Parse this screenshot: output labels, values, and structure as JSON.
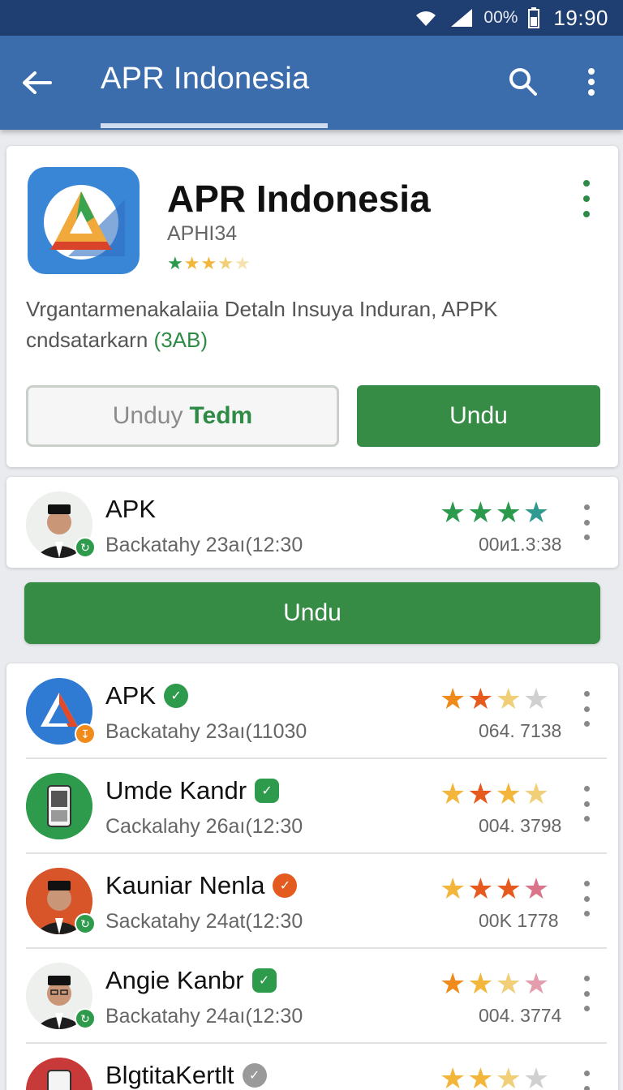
{
  "status_bar": {
    "battery": "00%",
    "time": "19:90"
  },
  "app_bar": {
    "title": "APR Indonesia"
  },
  "hero": {
    "app_name": "APR Indonesia",
    "app_id": "APHI34",
    "rating_stars": 3.5,
    "description_main": "Vrgantarmenakalaiia Detaln Insuya Induran, APPK cndsatarkarn ",
    "description_highlight": "(3AB)",
    "btn_outline_part1": "Unduy",
    "btn_outline_part2": "Tedm",
    "btn_fill": "Undu"
  },
  "featured_row": {
    "name": "APK",
    "subtitle": "Backatahy 23aı(12:30",
    "count": "00и1.3ː38",
    "stars": 4
  },
  "big_button": "Undu",
  "list": [
    {
      "name": "APK",
      "subtitle": "Backatahy 23aı(11030",
      "count": "064. 7138",
      "stars": 2.5,
      "accent": "#2e9a4b"
    },
    {
      "name": "Umde Kandr",
      "subtitle": "Cackalahy 26aı(12:30",
      "count": "004. 3798",
      "stars": 2.5,
      "accent": "#2e9a4b"
    },
    {
      "name": "Kauniar Nenla",
      "subtitle": "Sackatahy 24at(12:30",
      "count": "00K 1778",
      "stars": 3.5,
      "accent": "#e35b1e"
    },
    {
      "name": "Angie Kanbr",
      "subtitle": "Backatahy 24aı(12:30",
      "count": "004. 3774",
      "stars": 2.5,
      "accent": "#2e9a4b"
    },
    {
      "name": "BlgtitaKertlt",
      "subtitle": "",
      "count": "",
      "stars": 2.5,
      "accent": "#9a9a9a"
    }
  ],
  "icons": [
    "wifi-icon",
    "signal-icon",
    "battery-icon",
    "back-arrow-icon",
    "search-icon",
    "more-vert-icon",
    "star-icon",
    "verified-badge-icon"
  ],
  "colors": {
    "primary": "#3b6dad",
    "status_bar": "#1f3f73",
    "accent_green": "#368c44"
  }
}
